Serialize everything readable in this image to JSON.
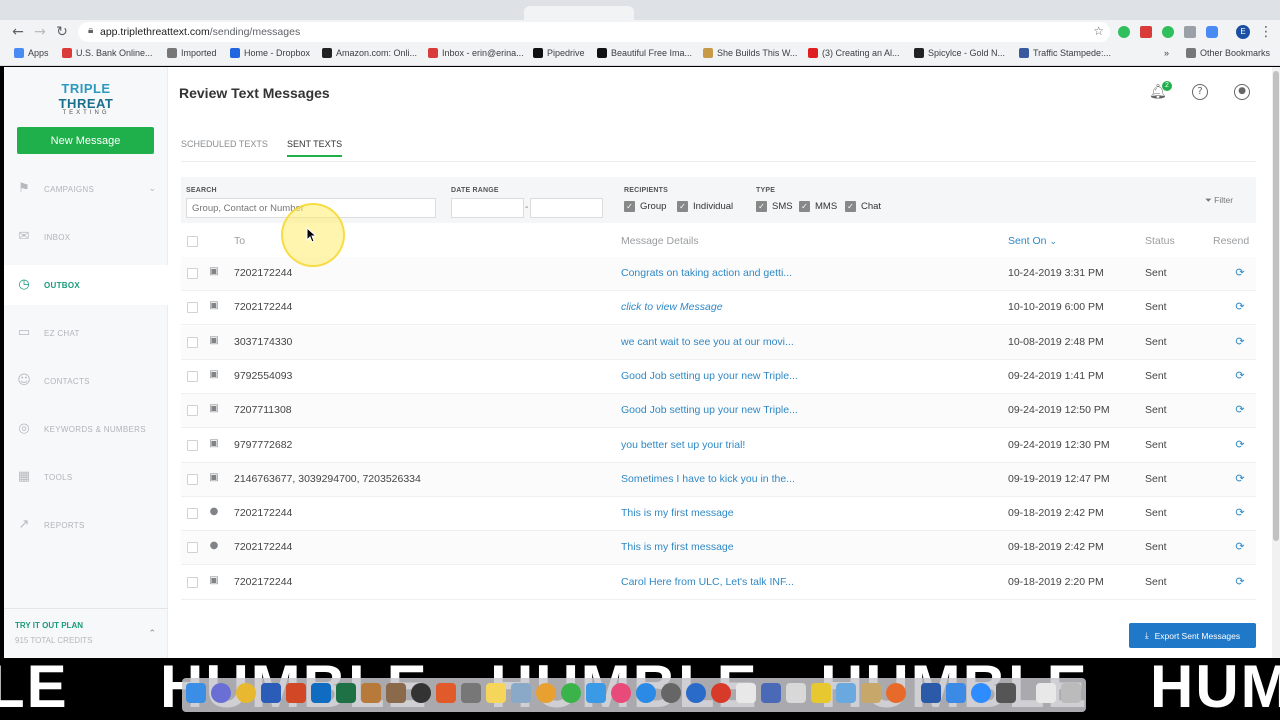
{
  "browser": {
    "url_host": "app.triplethreattext.com",
    "url_path": "/sending/messages",
    "bookmarks": [
      "Apps",
      "U.S. Bank Online...",
      "Imported",
      "Home - Dropbox",
      "Amazon.com: Onli...",
      "Inbox - erin@erina...",
      "Pipedrive",
      "Beautiful Free Ima...",
      "She Builds This W...",
      "(3) Creating an Al...",
      "Spicylce - Gold N...",
      "Traffic Stampede:..."
    ],
    "other_bookmarks": "Other Bookmarks",
    "profile_letter": "E"
  },
  "sidebar": {
    "logo_line1_a": "TRIPLE",
    "logo_line1_b": "THREAT",
    "logo_line2": "TEXTING",
    "new_message": "New Message",
    "items": [
      {
        "label": "CAMPAIGNS",
        "icon": "flag-icon"
      },
      {
        "label": "INBOX",
        "icon": "mail-icon"
      },
      {
        "label": "OUTBOX",
        "icon": "clock-icon"
      },
      {
        "label": "EZ CHAT",
        "icon": "chat-icon"
      },
      {
        "label": "CONTACTS",
        "icon": "contacts-icon"
      },
      {
        "label": "KEYWORDS & NUMBERS",
        "icon": "target-icon"
      },
      {
        "label": "TOOLS",
        "icon": "grid-icon"
      },
      {
        "label": "REPORTS",
        "icon": "chart-icon"
      }
    ],
    "plan_name": "TRY IT OUT PLAN",
    "plan_credits": "915 TOTAL CREDITS"
  },
  "header": {
    "title": "Review Text Messages",
    "notification_count": "2"
  },
  "tabs": {
    "scheduled": "SCHEDULED TEXTS",
    "sent": "SENT TEXTS"
  },
  "filters": {
    "search_label": "SEARCH",
    "search_placeholder": "Group, Contact or Number",
    "date_range_label": "DATE RANGE",
    "recipients_label": "RECIPIENTS",
    "group": "Group",
    "individual": "Individual",
    "type_label": "TYPE",
    "sms": "SMS",
    "mms": "MMS",
    "chat": "Chat",
    "filter_button": "Filter"
  },
  "table": {
    "col_to": "To",
    "col_details": "Message Details",
    "col_sent_on": "Sent On",
    "col_status": "Status",
    "col_resend": "Resend",
    "rows": [
      {
        "to": "7202172244",
        "type_icon": "image-icon",
        "details": "Congrats on taking action and getti...",
        "sent_on": "10-24-2019 3:31 PM",
        "status": "Sent"
      },
      {
        "to": "7202172244",
        "type_icon": "image-icon",
        "details": "click to view Message",
        "sent_on": "10-10-2019 6:00 PM",
        "status": "Sent"
      },
      {
        "to": "3037174330",
        "type_icon": "image-icon",
        "details": "we cant wait to see you at our movi...",
        "sent_on": "10-08-2019 2:48 PM",
        "status": "Sent"
      },
      {
        "to": "9792554093",
        "type_icon": "image-icon",
        "details": "Good Job setting up your new Triple...",
        "sent_on": "09-24-2019 1:41 PM",
        "status": "Sent"
      },
      {
        "to": "7207711308",
        "type_icon": "image-icon",
        "details": "Good Job setting up your new Triple...",
        "sent_on": "09-24-2019 12:50 PM",
        "status": "Sent"
      },
      {
        "to": "9797772682",
        "type_icon": "image-icon",
        "details": "you better set up your trial!",
        "sent_on": "09-24-2019 12:30 PM",
        "status": "Sent"
      },
      {
        "to": "2146763677, 3039294700, 7203526334",
        "type_icon": "image-icon",
        "details": "Sometimes I have to kick you in the...",
        "sent_on": "09-19-2019 12:47 PM",
        "status": "Sent"
      },
      {
        "to": "7202172244",
        "type_icon": "chat-bubble-icon",
        "details": "This is my first message",
        "sent_on": "09-18-2019 2:42 PM",
        "status": "Sent"
      },
      {
        "to": "7202172244",
        "type_icon": "chat-bubble-icon",
        "details": "This is my first message",
        "sent_on": "09-18-2019 2:42 PM",
        "status": "Sent"
      },
      {
        "to": "7202172244",
        "type_icon": "image-icon",
        "details": "Carol Here from ULC, Let's talk INF...",
        "sent_on": "09-18-2019 2:20 PM",
        "status": "Sent"
      }
    ]
  },
  "export_button": "Export Sent Messages",
  "desktop_text": "HUMBLE",
  "colors": {
    "accent_green": "#20b04b",
    "link_blue": "#2f89c5",
    "export_blue": "#1f78c8",
    "active_teal": "#1a9a7c"
  }
}
